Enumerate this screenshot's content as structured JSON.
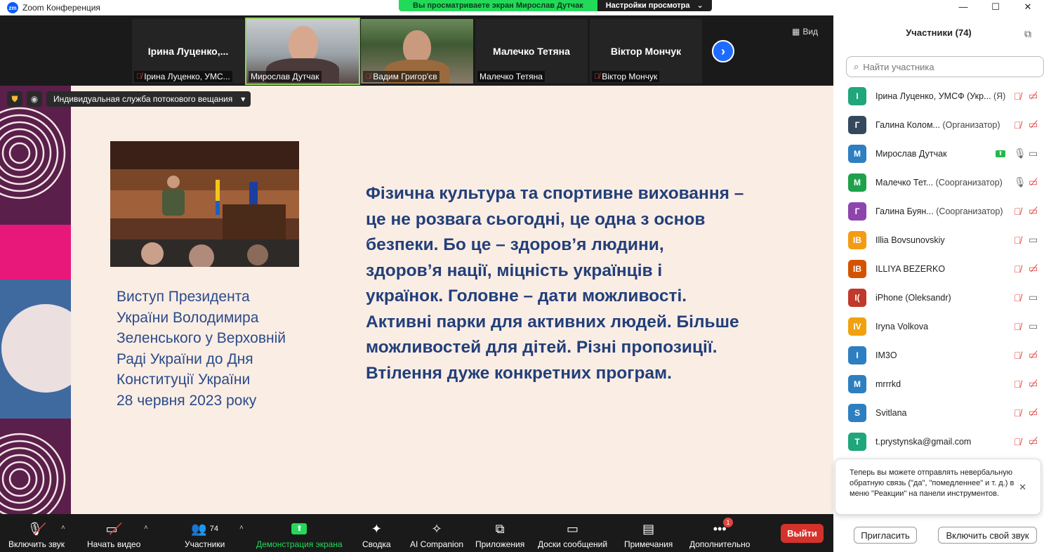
{
  "window": {
    "app_title": "Zoom Конференция",
    "logo_text": "zm",
    "minimize": "—",
    "maximize": "☐",
    "close": "✕"
  },
  "share_banner": {
    "viewing": "Вы просматриваете экран Мирослав Дутчак",
    "settings": "Настройки просмотра",
    "caret": "⌄"
  },
  "gallery": {
    "view_label": "Вид",
    "next": "›",
    "tiles": [
      {
        "name": "Ірина  Луценко,...",
        "label": "Ірина Луценко, УМС...",
        "muted": true,
        "video": false
      },
      {
        "name": "",
        "label": "Мирослав Дутчак",
        "muted": false,
        "video": true
      },
      {
        "name": "",
        "label": "Вадим Григор'єв",
        "muted": true,
        "video": true
      },
      {
        "name": "Малечко Тетяна",
        "label": "Малечко Тетяна",
        "muted": false,
        "video": false
      },
      {
        "name": "Віктор Мончук",
        "label": "Віктор Мончук",
        "muted": true,
        "video": false
      }
    ]
  },
  "stream": {
    "dropdown": "Индивидуальная служба потокового вещания",
    "caret": "▾"
  },
  "slide": {
    "caption_lines": [
      "Виступ Президента",
      "України Володимира",
      "Зеленського у Верховній",
      "Раді України до Дня",
      "Конституції України",
      "28 червня 2023 року"
    ],
    "quote_lines": [
      "Фізична культура та спортивне виховання –",
      "це не розвага сьогодні, це одна з основ",
      "безпеки. Бо це – здоров’я людини,",
      "здоров’я нації, міцність українців і",
      "українок. Головне – дати можливості.",
      "Активні парки для активних людей. Більше",
      "можливостей для дітей. Різні пропозиції.",
      "Втілення дуже конкретних програм."
    ]
  },
  "toolbar": {
    "unmute": "Включить звук",
    "start_video": "Начать видео",
    "participants": "Участники",
    "participants_count": "74",
    "share_screen": "Демонстрация экрана",
    "summary": "Сводка",
    "ai_companion": "AI Companion",
    "apps": "Приложения",
    "whiteboards": "Доски сообщений",
    "notes": "Примечания",
    "more": "Дополнительно",
    "more_badge": "1",
    "leave": "Выйти",
    "caret": "˄"
  },
  "panel": {
    "title": "Участники (74)",
    "search_placeholder": "Найти участника",
    "participants": [
      {
        "initials": "I",
        "color": "#1fa67a",
        "name": "Ірина Луценко, УМСФ (Укр...",
        "role": "(Я)",
        "mic": "off",
        "cam": "off",
        "sharing": false
      },
      {
        "initials": "Г",
        "color": "#34495e",
        "name": "Галина Колом...",
        "role": "(Организатор)",
        "mic": "off",
        "cam": "off",
        "sharing": false
      },
      {
        "initials": "М",
        "color": "#2d7fc1",
        "name": "Мирослав Дутчак",
        "role": "",
        "mic": "on",
        "cam": "on",
        "sharing": true
      },
      {
        "initials": "М",
        "color": "#1fa14b",
        "name": "Малечко Тет...",
        "role": "(Соорганизатор)",
        "mic": "on",
        "cam": "off",
        "sharing": false
      },
      {
        "initials": "Г",
        "color": "#8e44ad",
        "name": "Галина Буян...",
        "role": "(Соорганизатор)",
        "mic": "off",
        "cam": "off",
        "sharing": false
      },
      {
        "initials": "IB",
        "color": "#f39c12",
        "name": "Illia Bovsunovskiy",
        "role": "",
        "mic": "off",
        "cam": "on",
        "sharing": false
      },
      {
        "initials": "IB",
        "color": "#d35400",
        "name": "ILLIYA BEZERKO",
        "role": "",
        "mic": "off",
        "cam": "off",
        "sharing": false
      },
      {
        "initials": "I(",
        "color": "#c0392b",
        "name": "iPhone (Oleksandr)",
        "role": "",
        "mic": "off",
        "cam": "on",
        "sharing": false
      },
      {
        "initials": "IV",
        "color": "#f1a10f",
        "name": "Iryna Volkova",
        "role": "",
        "mic": "off",
        "cam": "on",
        "sharing": false
      },
      {
        "initials": "I",
        "color": "#2d7fc1",
        "name": "IM3O",
        "role": "",
        "mic": "off",
        "cam": "off",
        "sharing": false
      },
      {
        "initials": "M",
        "color": "#2d7fc1",
        "name": "mrrrkd",
        "role": "",
        "mic": "off",
        "cam": "off",
        "sharing": false
      },
      {
        "initials": "S",
        "color": "#2d7fc1",
        "name": "Svitlana",
        "role": "",
        "mic": "off",
        "cam": "off",
        "sharing": false
      },
      {
        "initials": "T",
        "color": "#1fa67a",
        "name": "t.prystynska@gmail.com",
        "role": "",
        "mic": "off",
        "cam": "off",
        "sharing": false
      }
    ],
    "tooltip": "Теперь вы можете отправлять невербальную обратную связь (\"да\", \"помедленнее\" и т. д.) в меню \"Реакции\" на панели инструментов.",
    "invite": "Пригласить",
    "unmute_self": "Включить свой звук"
  }
}
